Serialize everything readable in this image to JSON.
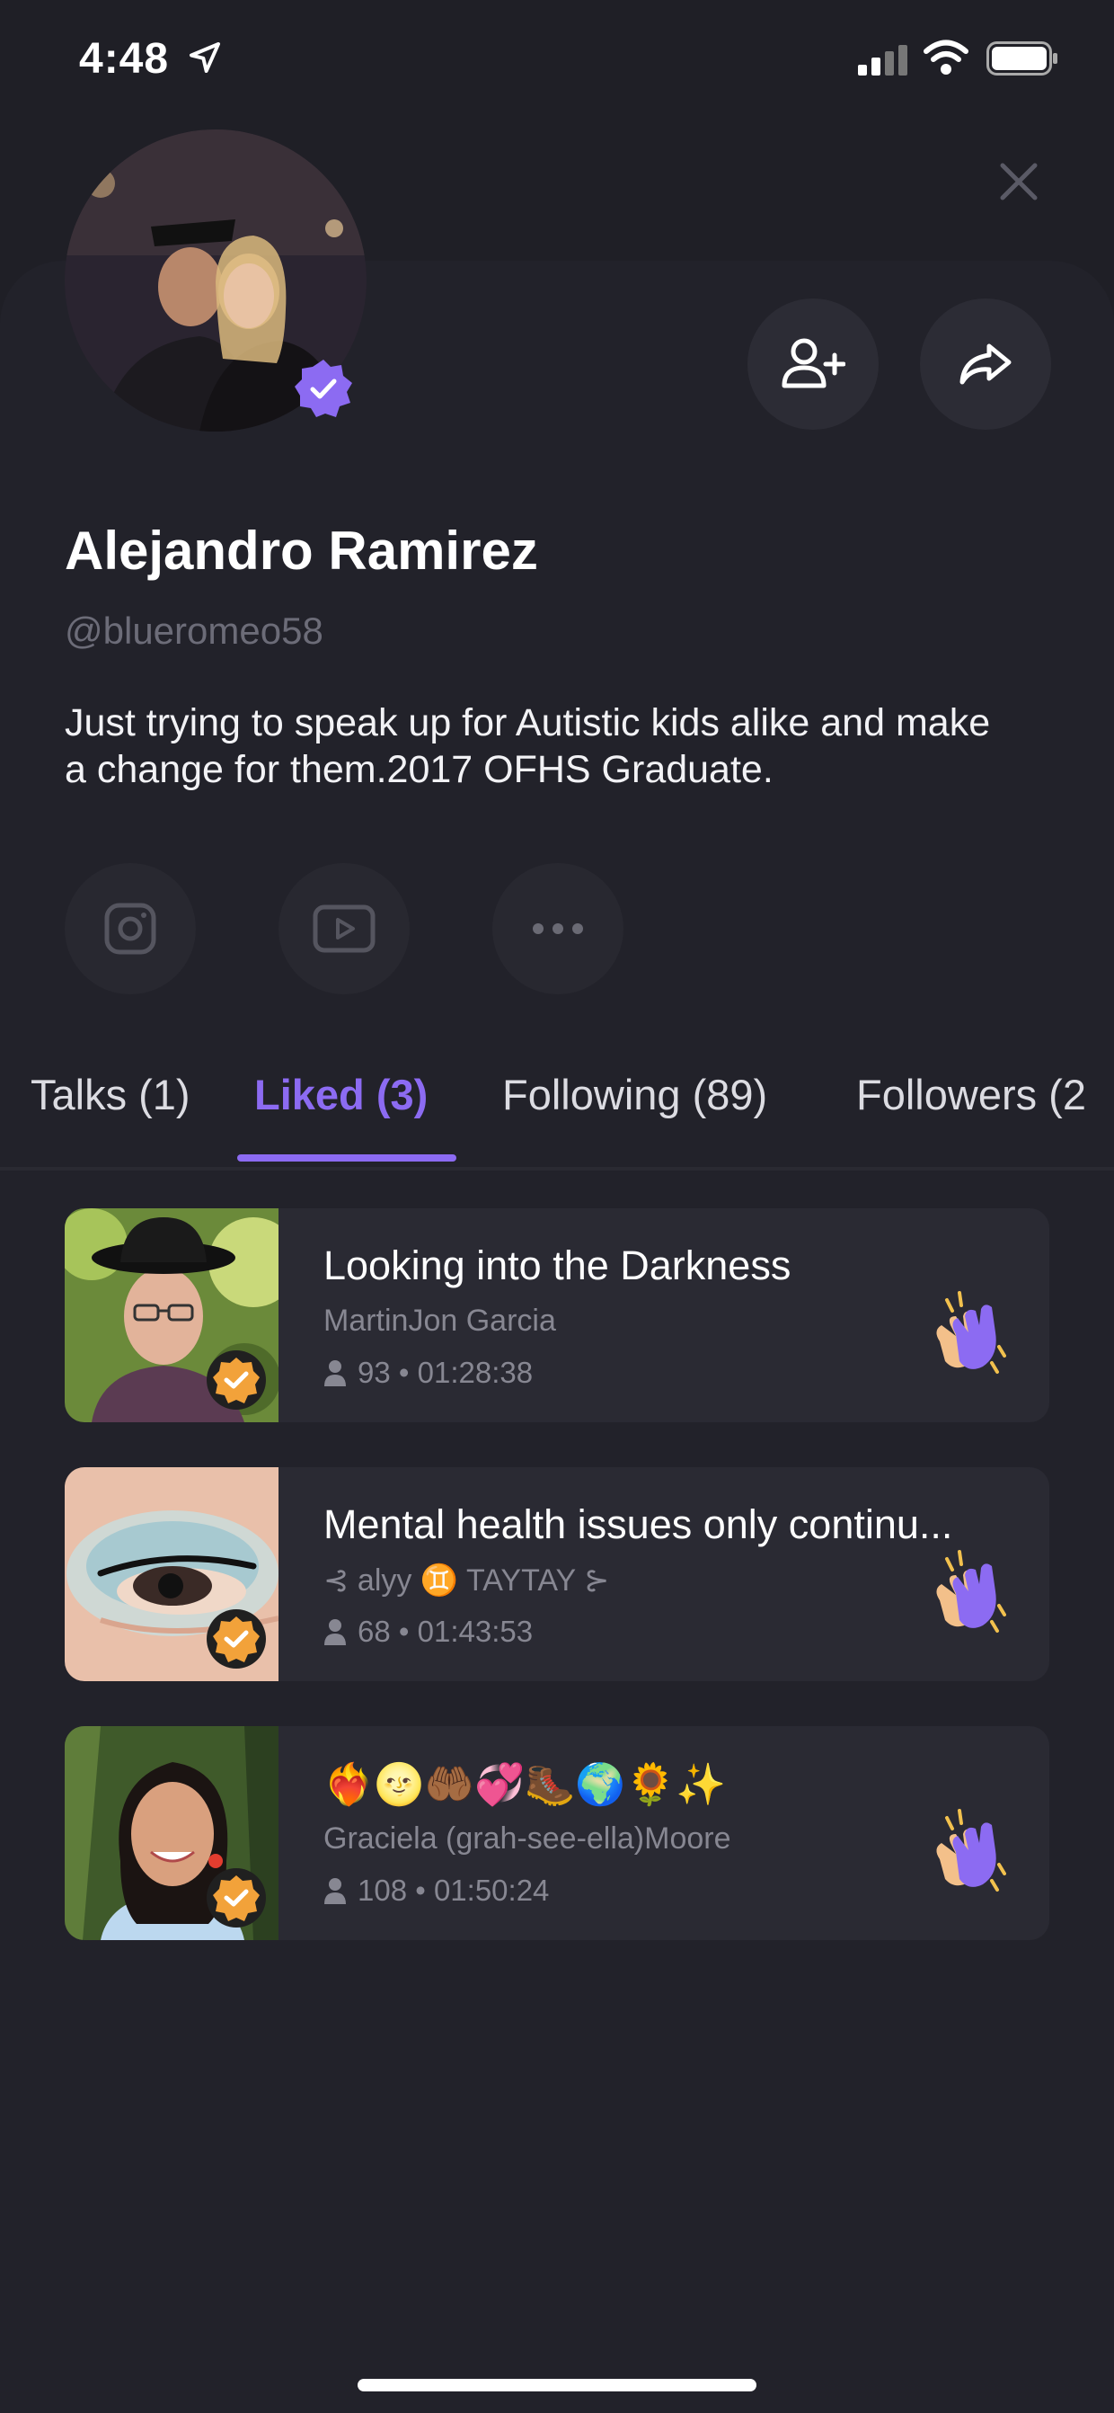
{
  "status_bar": {
    "time": "4:48",
    "icons": [
      "location-arrow-icon",
      "signal-icon",
      "wifi-icon",
      "battery-icon"
    ]
  },
  "profile": {
    "name": "Alejandro Ramirez",
    "handle": "@blueromeo58",
    "bio": "Just trying to speak up for Autistic kids alike and make a change for them.2017 OFHS Graduate.",
    "verified": true
  },
  "actions": {
    "follow_icon": "add-person-icon",
    "share_icon": "share-arrow-icon",
    "close_icon": "close-icon"
  },
  "social": [
    "instagram-icon",
    "youtube-icon",
    "more-dots-icon"
  ],
  "tabs": [
    {
      "label": "Talks (1)",
      "active": false
    },
    {
      "label": "Liked (3)",
      "active": true
    },
    {
      "label": "Following (89)",
      "active": false
    },
    {
      "label": "Followers (2",
      "active": false
    }
  ],
  "liked_talks": [
    {
      "title": "Looking into the Darkness",
      "host": "MartinJon Garcia",
      "listeners": "93",
      "duration": "01:28:38"
    },
    {
      "title": "Mental health issues only continu...",
      "host": "⊰ alyy ♊ TAYTAY ⊱",
      "listeners": "68",
      "duration": "01:43:53"
    },
    {
      "title": "❤️‍🔥🌝🤲🏾💞🥾🌍🌻✨",
      "host": "Graciela (grah-see-ella)Moore",
      "listeners": "108",
      "duration": "01:50:24"
    }
  ],
  "colors": {
    "accent": "#8c6bf2",
    "background": "#1f1f26",
    "card": "#2a2a33",
    "badge_orange": "#f2a23a"
  }
}
